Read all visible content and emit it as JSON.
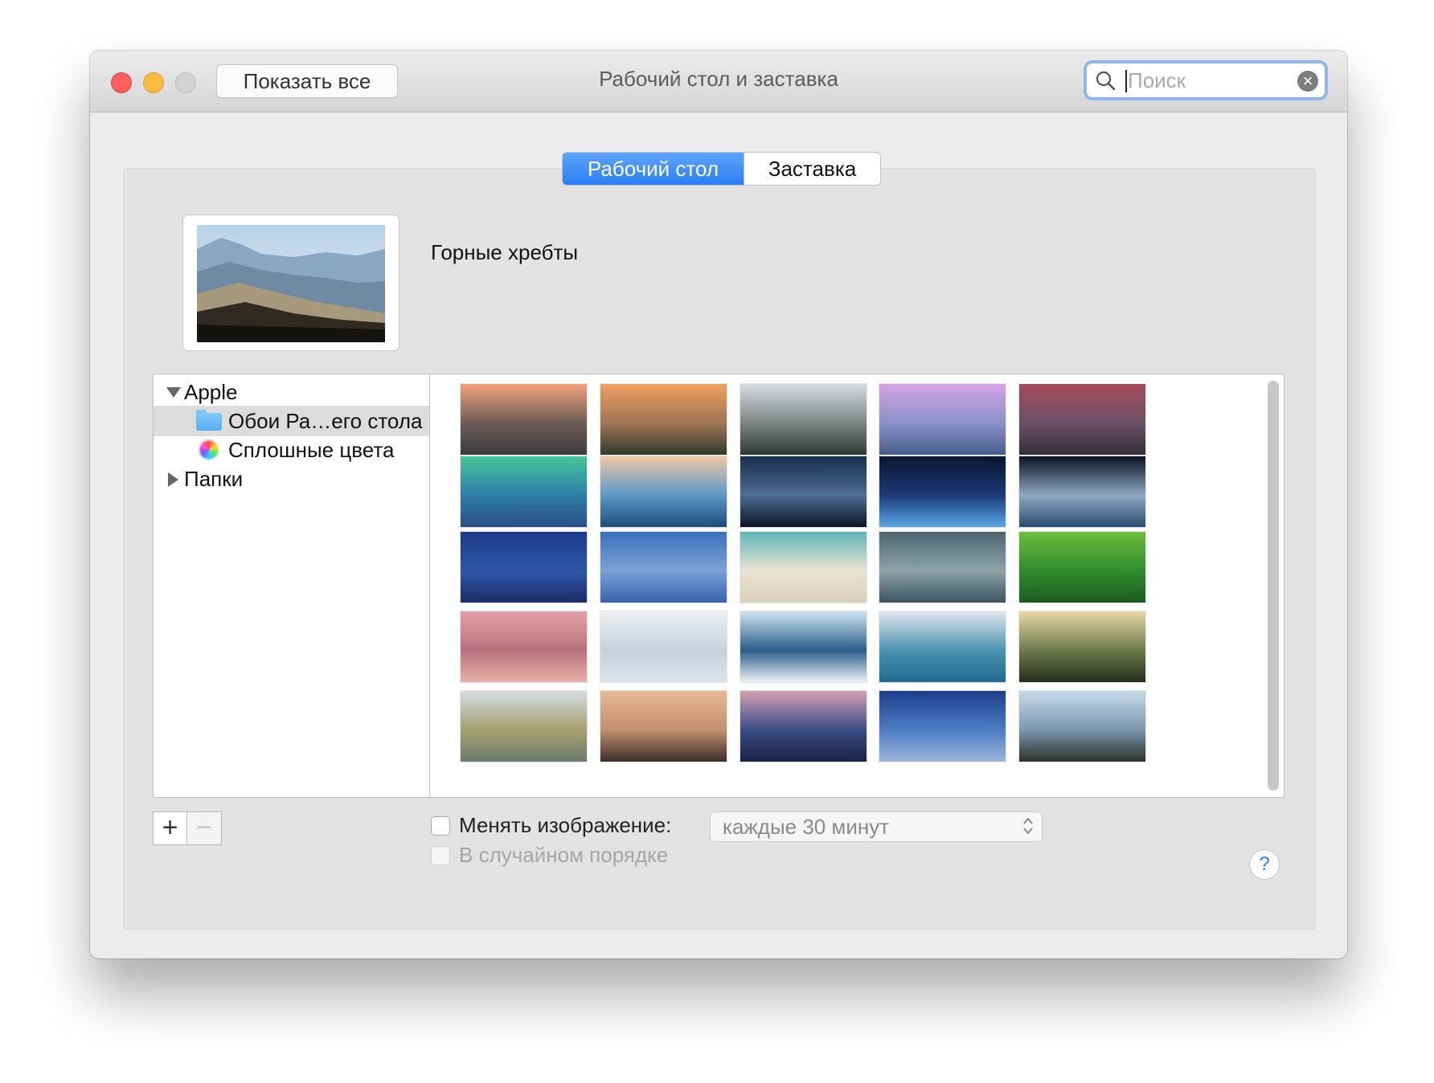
{
  "window": {
    "title": "Рабочий стол и заставка",
    "show_all_label": "Показать все",
    "search": {
      "placeholder": "Поиск"
    }
  },
  "tabs": [
    {
      "label": "Рабочий стол",
      "active": true
    },
    {
      "label": "Заставка",
      "active": false
    }
  ],
  "current_wallpaper": {
    "name": "Горные хребты"
  },
  "sidebar": {
    "apple_group": "Apple",
    "items": [
      {
        "label": "Обои Ра…его стола",
        "icon": "folder-icon",
        "selected": true
      },
      {
        "label": "Сплошные цвета",
        "icon": "color-wheel-icon",
        "selected": false
      }
    ],
    "folders_group": "Папки"
  },
  "wallpapers": [
    {
      "name": "yosemite-half-dome-sunset",
      "colors": [
        "#f2a37a",
        "#6e5d5a",
        "#3e3a3d"
      ]
    },
    {
      "name": "el-capitan-sunset",
      "colors": [
        "#f0a060",
        "#a07658",
        "#2e3d2a"
      ]
    },
    {
      "name": "yosemite-snow",
      "colors": [
        "#d8dde0",
        "#7b8582",
        "#2d3a33"
      ]
    },
    {
      "name": "half-dome-purple-sky",
      "colors": [
        "#d4a2e6",
        "#8a92c8",
        "#485d8a"
      ]
    },
    {
      "name": "lake-rocks-dusk",
      "colors": [
        "#a64a5c",
        "#6b5166",
        "#35303a"
      ]
    },
    {
      "name": "green-wave",
      "colors": [
        "#47c59b",
        "#2e7fa8",
        "#2a4f87"
      ]
    },
    {
      "name": "blue-wave-sunset",
      "colors": [
        "#f0c9a5",
        "#5d98c7",
        "#1f4c7a"
      ]
    },
    {
      "name": "andromeda-galaxy",
      "colors": [
        "#1a2f4f",
        "#4d6d92",
        "#0c1426"
      ]
    },
    {
      "name": "earth-horizon-moon",
      "colors": [
        "#0a1530",
        "#1b3a78",
        "#5aa7e6"
      ]
    },
    {
      "name": "earth-from-orbit",
      "colors": [
        "#0c1222",
        "#8ea8c2",
        "#2c4c70"
      ]
    },
    {
      "name": "milky-way-blue",
      "colors": [
        "#1c3a86",
        "#2f56aa",
        "#1a2d66"
      ]
    },
    {
      "name": "blue-sky-moon",
      "colors": [
        "#3a6fba",
        "#7ca2d6",
        "#3562ac"
      ]
    },
    {
      "name": "beach-shore",
      "colors": [
        "#5fb4b8",
        "#e9e3d2",
        "#d9d0b9"
      ]
    },
    {
      "name": "storm-clouds",
      "colors": [
        "#4c6670",
        "#8ea2a8",
        "#3d5560"
      ]
    },
    {
      "name": "rice-terraces",
      "colors": [
        "#6fbe3d",
        "#2f8b2e",
        "#1e5c22"
      ]
    },
    {
      "name": "pink-sand-dunes",
      "colors": [
        "#e4a0a8",
        "#b8727f",
        "#e8b0a6"
      ]
    },
    {
      "name": "snow-drifts",
      "colors": [
        "#eef1f4",
        "#c6d0dd",
        "#dee4ec"
      ]
    },
    {
      "name": "ice-cracks",
      "colors": [
        "#cfe3ef",
        "#2b5d8a",
        "#eaf2f7"
      ]
    },
    {
      "name": "blue-lake-trees",
      "colors": [
        "#dfe8ee",
        "#4b93b0",
        "#1f6a8f"
      ]
    },
    {
      "name": "misty-forest-light",
      "colors": [
        "#e8d8a6",
        "#6c7a4c",
        "#27301e"
      ]
    },
    {
      "name": "autumn-fog-forest",
      "colors": [
        "#d6dde0",
        "#a5a070",
        "#6c7a6e"
      ]
    },
    {
      "name": "island-sunset-lake",
      "colors": [
        "#e7b896",
        "#c28f70",
        "#3b2e28"
      ]
    },
    {
      "name": "lake-mountain-dusk",
      "colors": [
        "#d6a0b4",
        "#3b4c86",
        "#1a2346"
      ]
    },
    {
      "name": "blue-horizon-sky",
      "colors": [
        "#1e3f8a",
        "#4d7cc4",
        "#9cb6d8"
      ]
    },
    {
      "name": "mountain-ridges",
      "colors": [
        "#c9dbe8",
        "#7b96ae",
        "#2a3329"
      ]
    }
  ],
  "controls": {
    "change_picture_label": "Менять изображение:",
    "change_picture_checked": false,
    "interval_value": "каждые 30 минут",
    "random_order_label": "В случайном порядке",
    "random_order_checked": false,
    "add_label": "+",
    "remove_label": "−",
    "help_label": "?"
  }
}
